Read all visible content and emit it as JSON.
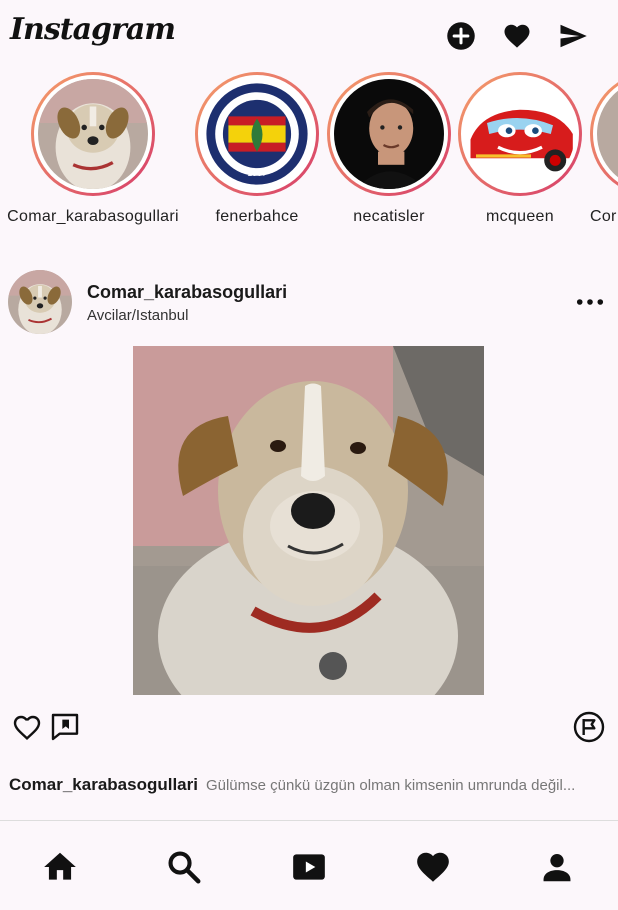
{
  "app": {
    "logo_text": "Instagram"
  },
  "header": {
    "icons": [
      "add-circle-icon",
      "heart-icon",
      "send-icon"
    ]
  },
  "stories": [
    {
      "name": "Comar_karabasogullari",
      "avatar": "dog"
    },
    {
      "name": "fenerbahce",
      "avatar": "fenerbahce-crest"
    },
    {
      "name": "necatisler",
      "avatar": "man-portrait"
    },
    {
      "name": "mcqueen",
      "avatar": "red-race-car"
    },
    {
      "name": "Cor",
      "avatar": "partial"
    }
  ],
  "post": {
    "username": "Comar_karabasogullari",
    "location": "Avcilar/Istanbul",
    "caption_user": "Comar_karabasogullari",
    "caption_text": "Gülümse çünkü üzgün olman kimsenin umrunda değil..."
  },
  "bottom_nav": [
    "home-icon",
    "search-icon",
    "reels-icon",
    "heart-icon",
    "profile-icon"
  ],
  "colors": {
    "background": "#fcf7fb",
    "story_ring_start": "#f5a06a",
    "story_ring_end": "#d63c6a",
    "icon": "#1a1a1a"
  }
}
